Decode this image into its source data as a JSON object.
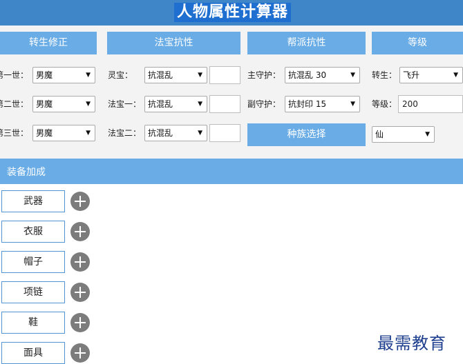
{
  "title": "人物属性计算器",
  "headers": {
    "rebirth": "转生修正",
    "treasure": "法宝抗性",
    "faction": "帮派抗性",
    "level": "等级"
  },
  "rebirth": {
    "rows": [
      {
        "label": "第一世：",
        "value": "男魔"
      },
      {
        "label": "第二世：",
        "value": "男魔"
      },
      {
        "label": "第三世：",
        "value": "男魔"
      }
    ]
  },
  "treasure": {
    "rows": [
      {
        "label": "灵宝：",
        "value": "抗混乱",
        "input": ""
      },
      {
        "label": "法宝一：",
        "value": "抗混乱",
        "input": ""
      },
      {
        "label": "法宝二：",
        "value": "抗混乱",
        "input": ""
      }
    ]
  },
  "faction": {
    "rows": [
      {
        "label": "主守护：",
        "value": "抗混乱 30"
      },
      {
        "label": "副守护：",
        "value": "抗封印 15"
      }
    ],
    "race_button": "种族选择"
  },
  "level": {
    "rebirth_label": "转生：",
    "rebirth_value": "飞升",
    "level_label": "等级：",
    "level_value": "200",
    "race_value": "仙"
  },
  "equipment": {
    "title": "装备加成",
    "items": [
      "武器",
      "衣服",
      "帽子",
      "项链",
      "鞋",
      "面具"
    ]
  },
  "watermark": "最需教育",
  "icons": {
    "dropdown": "chevron-down-icon",
    "add": "plus-circle-icon"
  },
  "colors": {
    "title_bar": "#3f86c9",
    "title_highlight": "#1f6fd1",
    "accent": "#6aace6",
    "panel": "#f3f3f3",
    "plus": "#7c7c7c"
  }
}
